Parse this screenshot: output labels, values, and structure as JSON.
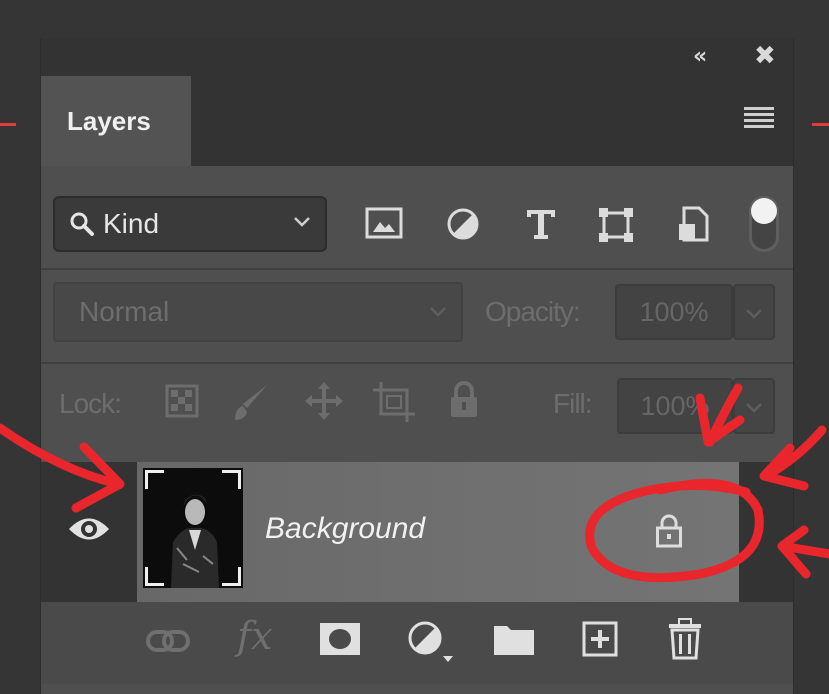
{
  "panel": {
    "collapse_glyph": "‹‹",
    "close_glyph": "✖",
    "tab_label": "Layers",
    "menu_icon": "hamburger-icon"
  },
  "filter": {
    "kind_label": "Kind",
    "icons": [
      "image-filter-icon",
      "adjustment-filter-icon",
      "type-filter-icon",
      "shape-filter-icon",
      "smart-object-filter-icon"
    ]
  },
  "blend": {
    "mode": "Normal",
    "opacity_label": "Opacity:",
    "opacity_value": "100%"
  },
  "lock": {
    "label": "Lock:",
    "icons": [
      "lock-transparent-icon",
      "lock-image-icon",
      "lock-position-icon",
      "lock-artboard-icon",
      "lock-all-icon"
    ],
    "fill_label": "Fill:",
    "fill_value": "100%"
  },
  "layer": {
    "name": "Background",
    "visible": true,
    "locked": true
  },
  "bottom_icons": [
    "link-layers-icon",
    "fx-icon",
    "add-mask-icon",
    "new-adjustment-icon",
    "new-group-icon",
    "new-layer-icon",
    "delete-icon"
  ],
  "fx_text": "fx",
  "colors": {
    "annotation": "#e8262c",
    "panel_bg": "#4f4f4f",
    "tab_bg": "#535353",
    "layer_row": "#6d6d6d"
  }
}
